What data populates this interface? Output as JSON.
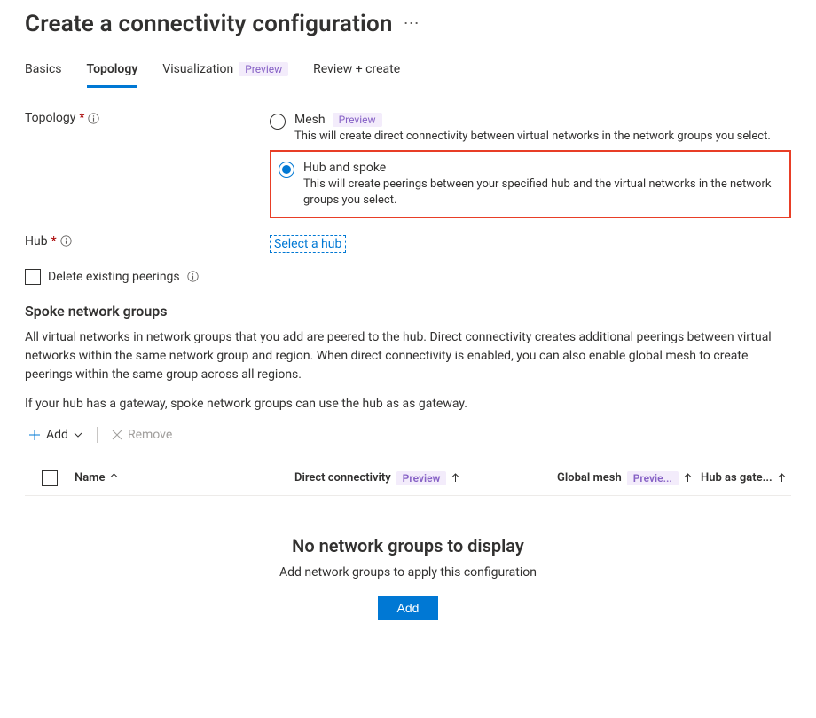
{
  "header": {
    "title": "Create a connectivity configuration"
  },
  "tabs": {
    "basics": "Basics",
    "topology": "Topology",
    "visualization": "Visualization",
    "visualization_badge": "Preview",
    "review": "Review + create"
  },
  "form": {
    "topology_label": "Topology",
    "mesh": {
      "title": "Mesh",
      "badge": "Preview",
      "desc": "This will create direct connectivity between virtual networks in the network groups you select."
    },
    "hub": {
      "title": "Hub and spoke",
      "desc": "This will create peerings between your specified hub and the virtual networks in the network groups you select."
    },
    "hub_label": "Hub",
    "select_hub": "Select a hub",
    "delete_peerings": "Delete existing peerings"
  },
  "spoke": {
    "heading": "Spoke network groups",
    "para1": "All virtual networks in network groups that you add are peered to the hub. Direct connectivity creates additional peerings between virtual networks within the same network group and region. When direct connectivity is enabled, you can also enable global mesh to create peerings within the same group across all regions.",
    "para2": "If your hub has a gateway, spoke network groups can use the hub as as gateway."
  },
  "toolbar": {
    "add": "Add",
    "remove": "Remove"
  },
  "table": {
    "col_name": "Name",
    "col_direct": "Direct connectivity",
    "col_direct_badge": "Preview",
    "col_global": "Global mesh",
    "col_global_badge": "Previe...",
    "col_gateway": "Hub as gate..."
  },
  "empty": {
    "title": "No network groups to display",
    "sub": "Add network groups to apply this configuration",
    "button": "Add"
  }
}
